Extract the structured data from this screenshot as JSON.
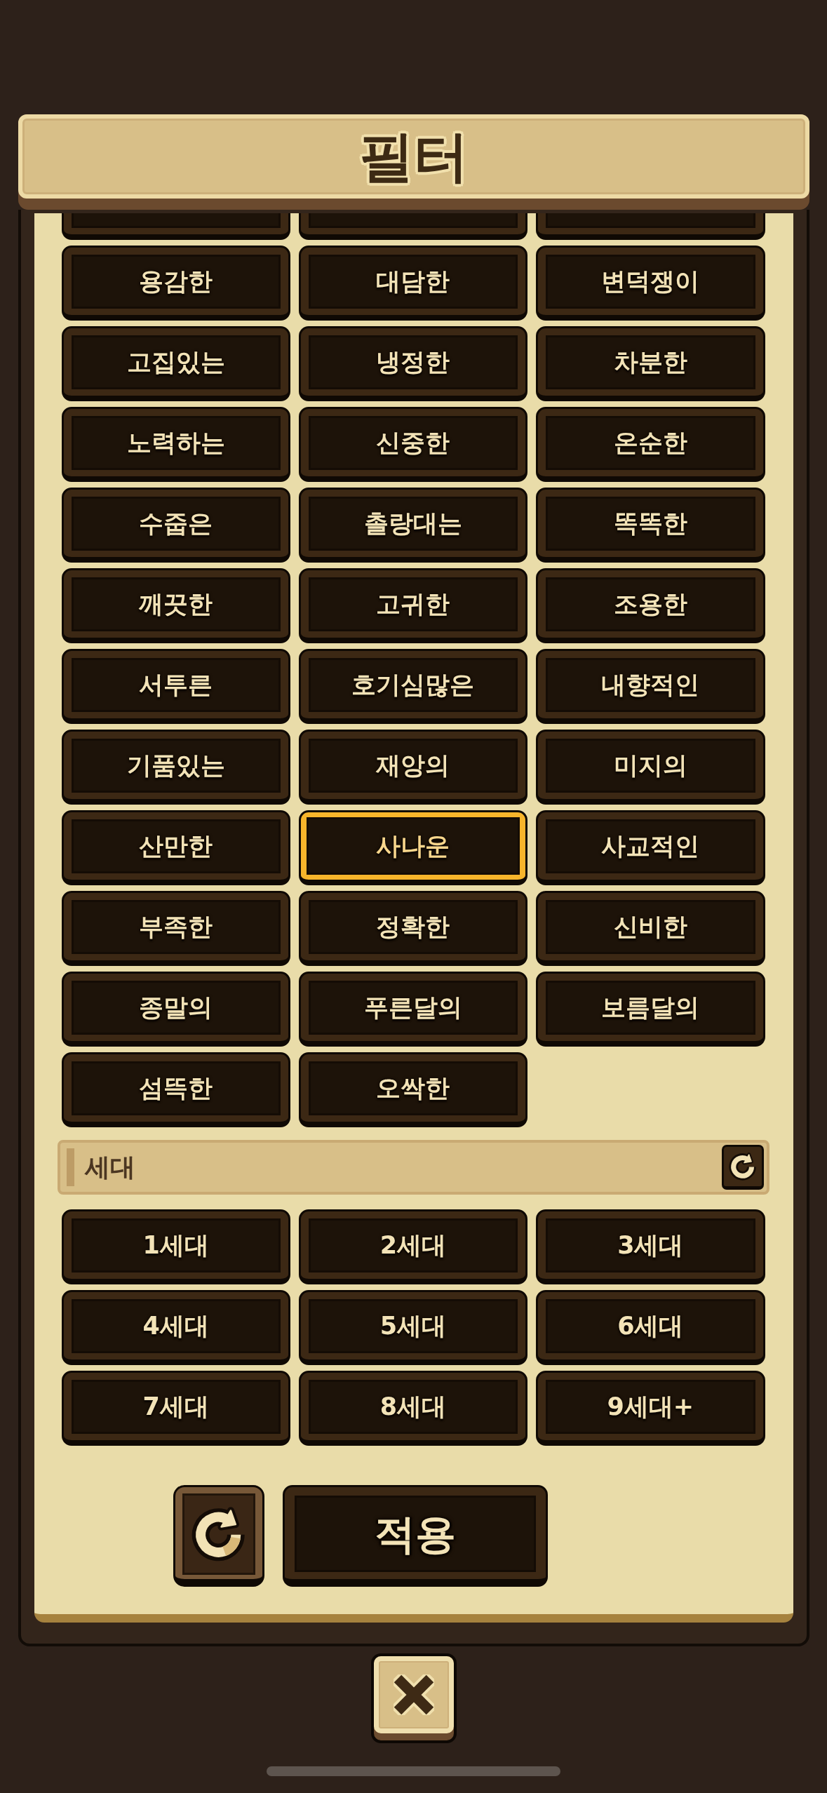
{
  "title": "필터",
  "trait_section": {
    "clipped_row": [
      {
        "clipped": true
      },
      {
        "clipped": true
      },
      {
        "clipped": true
      }
    ],
    "options": [
      {
        "label": "용감한",
        "selected": false
      },
      {
        "label": "대담한",
        "selected": false
      },
      {
        "label": "변덕쟁이",
        "selected": false
      },
      {
        "label": "고집있는",
        "selected": false
      },
      {
        "label": "냉정한",
        "selected": false
      },
      {
        "label": "차분한",
        "selected": false
      },
      {
        "label": "노력하는",
        "selected": false
      },
      {
        "label": "신중한",
        "selected": false
      },
      {
        "label": "온순한",
        "selected": false
      },
      {
        "label": "수줍은",
        "selected": false
      },
      {
        "label": "촐랑대는",
        "selected": false
      },
      {
        "label": "똑똑한",
        "selected": false
      },
      {
        "label": "깨끗한",
        "selected": false
      },
      {
        "label": "고귀한",
        "selected": false
      },
      {
        "label": "조용한",
        "selected": false
      },
      {
        "label": "서투른",
        "selected": false
      },
      {
        "label": "호기심많은",
        "selected": false
      },
      {
        "label": "내향적인",
        "selected": false
      },
      {
        "label": "기품있는",
        "selected": false
      },
      {
        "label": "재앙의",
        "selected": false
      },
      {
        "label": "미지의",
        "selected": false
      },
      {
        "label": "산만한",
        "selected": false
      },
      {
        "label": "사나운",
        "selected": true
      },
      {
        "label": "사교적인",
        "selected": false
      },
      {
        "label": "부족한",
        "selected": false
      },
      {
        "label": "정확한",
        "selected": false
      },
      {
        "label": "신비한",
        "selected": false
      },
      {
        "label": "종말의",
        "selected": false
      },
      {
        "label": "푸른달의",
        "selected": false
      },
      {
        "label": "보름달의",
        "selected": false
      },
      {
        "label": "섬뜩한",
        "selected": false
      },
      {
        "label": "오싹한",
        "selected": false
      }
    ]
  },
  "generation_section": {
    "title": "세대",
    "options": [
      {
        "label": "1세대",
        "selected": false
      },
      {
        "label": "2세대",
        "selected": false
      },
      {
        "label": "3세대",
        "selected": false
      },
      {
        "label": "4세대",
        "selected": false
      },
      {
        "label": "5세대",
        "selected": false
      },
      {
        "label": "6세대",
        "selected": false
      },
      {
        "label": "7세대",
        "selected": false
      },
      {
        "label": "8세대",
        "selected": false
      },
      {
        "label": "9세대+",
        "selected": false
      }
    ]
  },
  "actions": [
    {
      "kind": "reset"
    },
    {
      "kind": "apply",
      "label": "적용"
    }
  ]
}
